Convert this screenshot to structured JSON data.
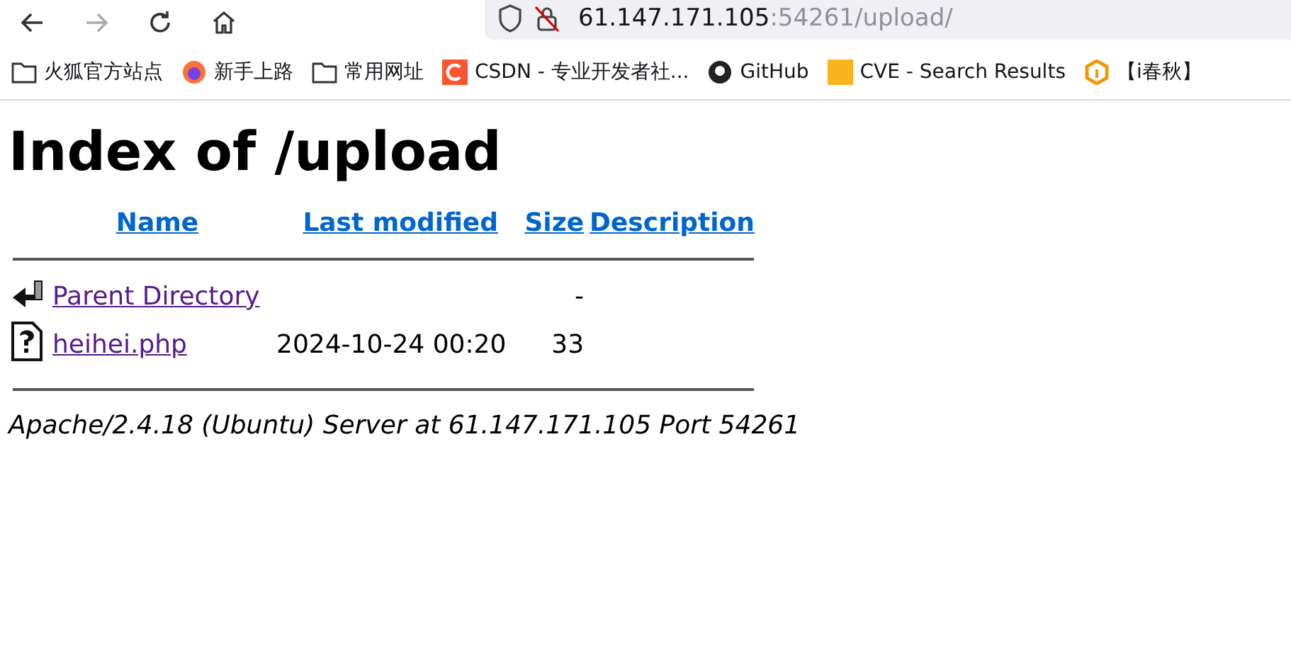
{
  "toolbar": {
    "buttons": [
      {
        "kind": "back",
        "disabled": false
      },
      {
        "kind": "forward",
        "disabled": true
      },
      {
        "kind": "reload",
        "disabled": false
      },
      {
        "kind": "home",
        "disabled": false
      }
    ],
    "address": {
      "host": "61.147.171.105",
      "rest": ":54261/upload/"
    }
  },
  "bookmarks": [
    {
      "kind": "folder",
      "label": "火狐官方站点"
    },
    {
      "kind": "firefox",
      "label": "新手上路"
    },
    {
      "kind": "folder",
      "label": "常用网址"
    },
    {
      "kind": "csdn",
      "label": "CSDN - 专业开发者社..."
    },
    {
      "kind": "github",
      "label": "GitHub"
    },
    {
      "kind": "square",
      "label": "CVE - Search Results"
    },
    {
      "kind": "ichunqiu",
      "label": "【i春秋】"
    }
  ],
  "page": {
    "title": "Index of /upload",
    "columns": [
      "Name",
      "Last modified",
      "Size",
      "Description"
    ],
    "rows": [
      {
        "kind": "back",
        "name": "Parent Directory",
        "size": "-"
      },
      {
        "kind": "unknown",
        "name": "heihei.php",
        "modified": "2024-10-24 00:20",
        "size": "33"
      }
    ],
    "footer": "Apache/2.4.18 (Ubuntu) Server at 61.147.171.105 Port 54261"
  }
}
